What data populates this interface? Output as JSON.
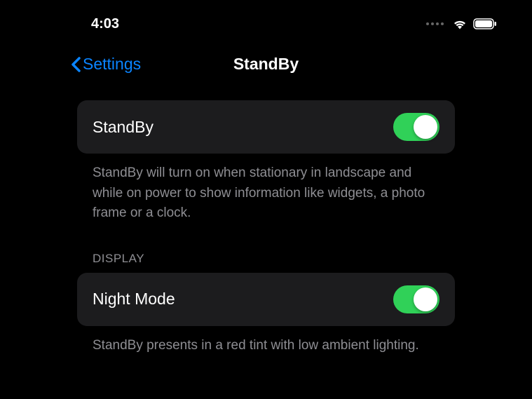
{
  "status": {
    "time": "4:03"
  },
  "nav": {
    "back_label": "Settings",
    "title": "StandBy"
  },
  "main_toggle": {
    "label": "StandBy",
    "footer": "StandBy will turn on when stationary in landscape and while on power to show information like widgets, a photo frame or a clock."
  },
  "display_section": {
    "header": "DISPLAY",
    "night_mode_label": "Night Mode",
    "night_mode_footer": "StandBy presents in a red tint with low ambient lighting."
  }
}
